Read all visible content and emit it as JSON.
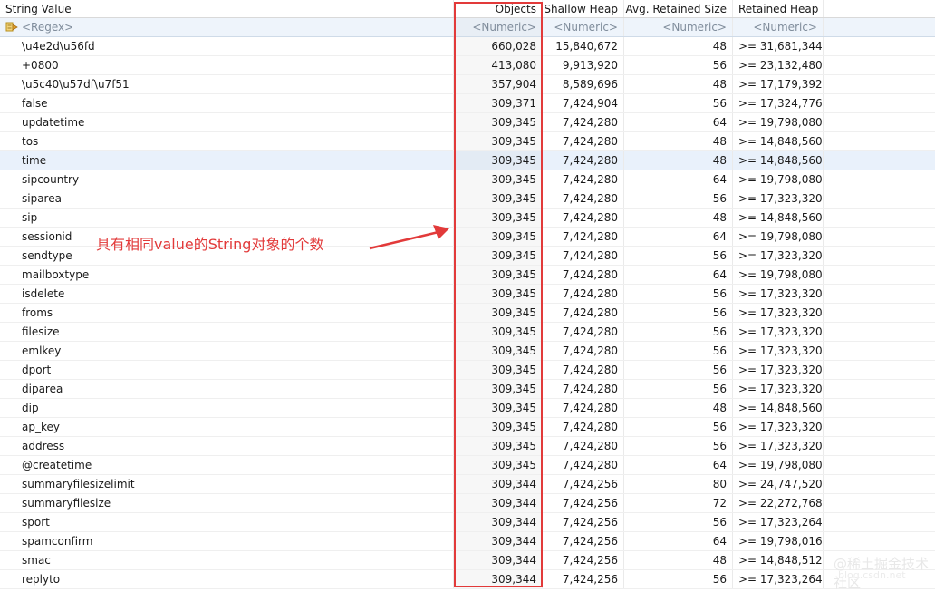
{
  "columns": {
    "name": "String Value",
    "objects": "Objects",
    "shallow": "Shallow Heap",
    "avg": "Avg. Retained Size",
    "retained": "Retained Heap"
  },
  "filter": {
    "name": "<Regex>",
    "objects": "<Numeric>",
    "shallow": "<Numeric>",
    "avg": "<Numeric>",
    "retained": "<Numeric>"
  },
  "rows": [
    {
      "name": "\\u4e2d\\u56fd",
      "objects": "660,028",
      "shallow": "15,840,672",
      "avg": "48",
      "retained": ">= 31,681,344"
    },
    {
      "name": "+0800",
      "objects": "413,080",
      "shallow": "9,913,920",
      "avg": "56",
      "retained": ">= 23,132,480"
    },
    {
      "name": "\\u5c40\\u57df\\u7f51",
      "objects": "357,904",
      "shallow": "8,589,696",
      "avg": "48",
      "retained": ">= 17,179,392"
    },
    {
      "name": "false",
      "objects": "309,371",
      "shallow": "7,424,904",
      "avg": "56",
      "retained": ">= 17,324,776"
    },
    {
      "name": "updatetime",
      "objects": "309,345",
      "shallow": "7,424,280",
      "avg": "64",
      "retained": ">= 19,798,080"
    },
    {
      "name": "tos",
      "objects": "309,345",
      "shallow": "7,424,280",
      "avg": "48",
      "retained": ">= 14,848,560"
    },
    {
      "name": "time",
      "objects": "309,345",
      "shallow": "7,424,280",
      "avg": "48",
      "retained": ">= 14,848,560"
    },
    {
      "name": "sipcountry",
      "objects": "309,345",
      "shallow": "7,424,280",
      "avg": "64",
      "retained": ">= 19,798,080"
    },
    {
      "name": "siparea",
      "objects": "309,345",
      "shallow": "7,424,280",
      "avg": "56",
      "retained": ">= 17,323,320"
    },
    {
      "name": "sip",
      "objects": "309,345",
      "shallow": "7,424,280",
      "avg": "48",
      "retained": ">= 14,848,560"
    },
    {
      "name": "sessionid",
      "objects": "309,345",
      "shallow": "7,424,280",
      "avg": "64",
      "retained": ">= 19,798,080"
    },
    {
      "name": "sendtype",
      "objects": "309,345",
      "shallow": "7,424,280",
      "avg": "56",
      "retained": ">= 17,323,320"
    },
    {
      "name": "mailboxtype",
      "objects": "309,345",
      "shallow": "7,424,280",
      "avg": "64",
      "retained": ">= 19,798,080"
    },
    {
      "name": "isdelete",
      "objects": "309,345",
      "shallow": "7,424,280",
      "avg": "56",
      "retained": ">= 17,323,320"
    },
    {
      "name": "froms",
      "objects": "309,345",
      "shallow": "7,424,280",
      "avg": "56",
      "retained": ">= 17,323,320"
    },
    {
      "name": "filesize",
      "objects": "309,345",
      "shallow": "7,424,280",
      "avg": "56",
      "retained": ">= 17,323,320"
    },
    {
      "name": "emlkey",
      "objects": "309,345",
      "shallow": "7,424,280",
      "avg": "56",
      "retained": ">= 17,323,320"
    },
    {
      "name": "dport",
      "objects": "309,345",
      "shallow": "7,424,280",
      "avg": "56",
      "retained": ">= 17,323,320"
    },
    {
      "name": "diparea",
      "objects": "309,345",
      "shallow": "7,424,280",
      "avg": "56",
      "retained": ">= 17,323,320"
    },
    {
      "name": "dip",
      "objects": "309,345",
      "shallow": "7,424,280",
      "avg": "48",
      "retained": ">= 14,848,560"
    },
    {
      "name": "ap_key",
      "objects": "309,345",
      "shallow": "7,424,280",
      "avg": "56",
      "retained": ">= 17,323,320"
    },
    {
      "name": "address",
      "objects": "309,345",
      "shallow": "7,424,280",
      "avg": "56",
      "retained": ">= 17,323,320"
    },
    {
      "name": "@createtime",
      "objects": "309,345",
      "shallow": "7,424,280",
      "avg": "64",
      "retained": ">= 19,798,080"
    },
    {
      "name": "summaryfilesizelimit",
      "objects": "309,344",
      "shallow": "7,424,256",
      "avg": "80",
      "retained": ">= 24,747,520"
    },
    {
      "name": "summaryfilesize",
      "objects": "309,344",
      "shallow": "7,424,256",
      "avg": "72",
      "retained": ">= 22,272,768"
    },
    {
      "name": "sport",
      "objects": "309,344",
      "shallow": "7,424,256",
      "avg": "56",
      "retained": ">= 17,323,264"
    },
    {
      "name": "spamconfirm",
      "objects": "309,344",
      "shallow": "7,424,256",
      "avg": "64",
      "retained": ">= 19,798,016"
    },
    {
      "name": "smac",
      "objects": "309,344",
      "shallow": "7,424,256",
      "avg": "48",
      "retained": ">= 14,848,512"
    },
    {
      "name": "replyto",
      "objects": "309,344",
      "shallow": "7,424,256",
      "avg": "56",
      "retained": ">= 17,323,264"
    }
  ],
  "selected_row": "time",
  "annotation": {
    "text": "具有相同value的String对象的个数",
    "color": "#e23a3a"
  },
  "watermark": {
    "line1": "@稀土掘金技术社区",
    "line2": "blog.csdn.net"
  },
  "icons": {
    "filter_icon": "regex-filter-icon"
  }
}
